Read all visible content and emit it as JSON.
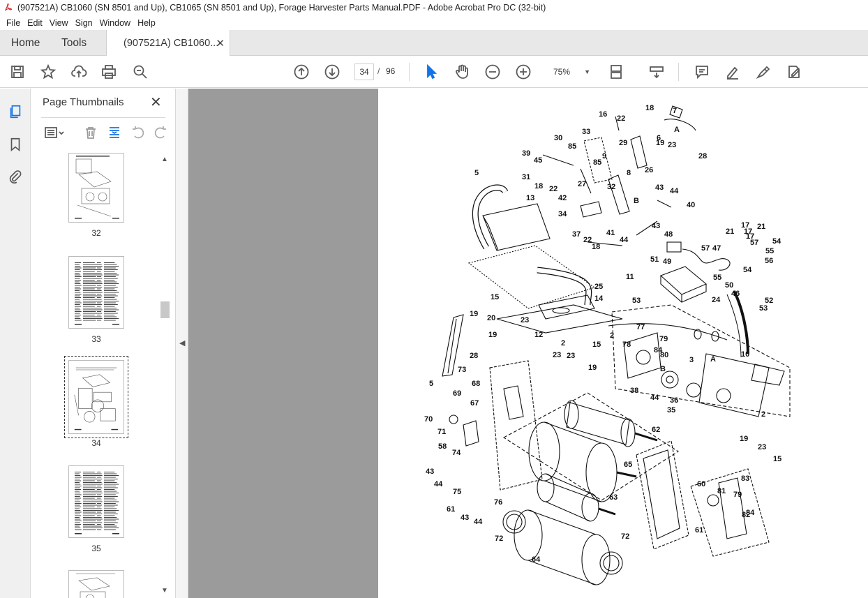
{
  "window": {
    "title": "(907521A) CB1060 (SN 8501 and Up), CB1065 (SN 8501 and Up), Forage Harvester Parts Manual.PDF - Adobe Acrobat Pro DC (32-bit)"
  },
  "menu": [
    "File",
    "Edit",
    "View",
    "Sign",
    "Window",
    "Help"
  ],
  "tabs": {
    "home": "Home",
    "tools": "Tools",
    "doc": "(907521A) CB1060..."
  },
  "toolbar": {
    "page_current": "34",
    "page_sep": "/",
    "page_total": "96",
    "zoom": "75%"
  },
  "thumbnails": {
    "title": "Page Thumbnails",
    "pages": [
      {
        "label": "32"
      },
      {
        "label": "33"
      },
      {
        "label": "34"
      },
      {
        "label": "35"
      }
    ]
  },
  "diagram": {
    "callouts": [
      "18",
      "7",
      "16",
      "22",
      "A",
      "33",
      "6",
      "30",
      "19",
      "23",
      "29",
      "28",
      "39",
      "85",
      "9",
      "45",
      "85",
      "26",
      "8",
      "31",
      "18",
      "22",
      "27",
      "43",
      "32",
      "44",
      "42",
      "B",
      "40",
      "5",
      "13",
      "34",
      "37",
      "22",
      "18",
      "41",
      "44",
      "43",
      "48",
      "17",
      "21",
      "17",
      "54",
      "17",
      "21",
      "57",
      "47",
      "57",
      "55",
      "56",
      "11",
      "49",
      "51",
      "54",
      "55",
      "50",
      "46",
      "52",
      "25",
      "53",
      "24",
      "53",
      "14",
      "15",
      "19",
      "20",
      "23",
      "12",
      "77",
      "19",
      "2",
      "2",
      "15",
      "78",
      "79",
      "10",
      "23",
      "28",
      "84",
      "80",
      "A",
      "3",
      "B",
      "23",
      "19",
      "73",
      "38",
      "44",
      "36",
      "35",
      "5",
      "68",
      "69",
      "67",
      "2",
      "70",
      "62",
      "71",
      "58",
      "74",
      "19",
      "23",
      "15",
      "65",
      "43",
      "44",
      "75",
      "60",
      "83",
      "81",
      "79",
      "76",
      "63",
      "84",
      "82",
      "61",
      "43",
      "44",
      "72",
      "72",
      "61",
      "64"
    ]
  },
  "colors": {
    "viewer_bg": "#9b9b9b",
    "panel_bg": "#f0f0f0",
    "accent": "#1473e6",
    "pdf_icon": "#d32626"
  }
}
